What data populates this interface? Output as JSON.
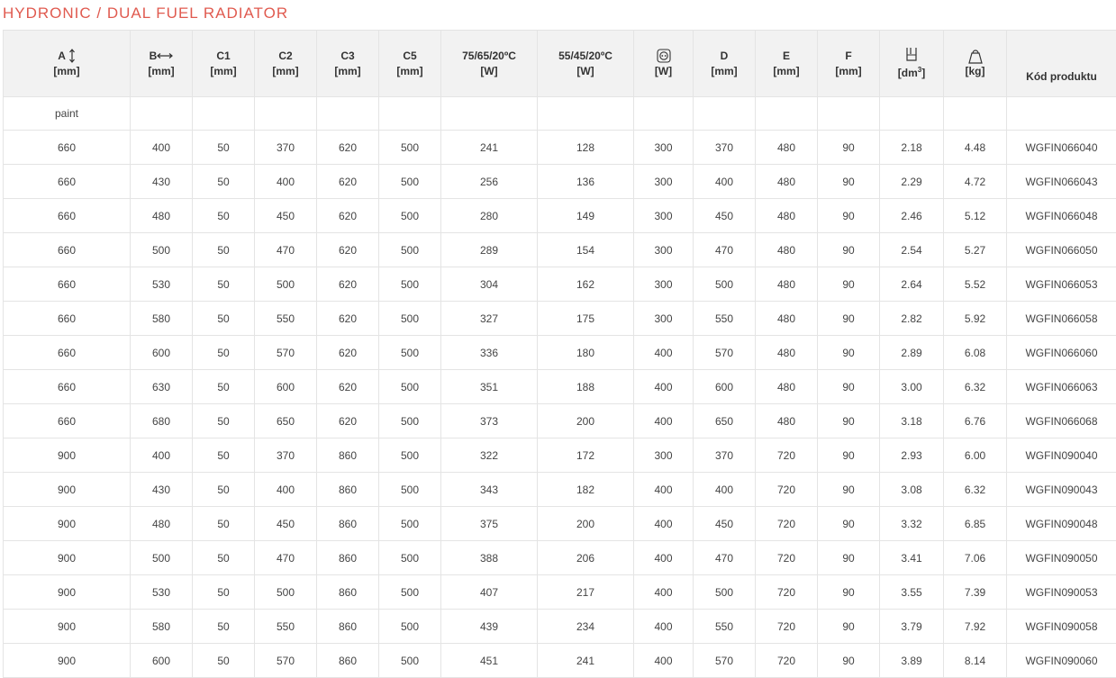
{
  "title": "HYDRONIC / DUAL FUEL RADIATOR",
  "headers": {
    "a": {
      "label": "A",
      "unit": "[mm]",
      "icon": "vertical-arrow-icon"
    },
    "b": {
      "label": "B",
      "unit": "[mm]",
      "icon": "horizontal-arrow-icon"
    },
    "c1": {
      "label": "C1",
      "unit": "[mm]"
    },
    "c2": {
      "label": "C2",
      "unit": "[mm]"
    },
    "c3": {
      "label": "C3",
      "unit": "[mm]"
    },
    "c5": {
      "label": "C5",
      "unit": "[mm]"
    },
    "p75": {
      "label": "75/65/20ºC",
      "unit": "[W]"
    },
    "p55": {
      "label": "55/45/20ºC",
      "unit": "[W]"
    },
    "heater": {
      "unit": "[W]",
      "icon": "power-socket-icon"
    },
    "d": {
      "label": "D",
      "unit": "[mm]"
    },
    "e": {
      "label": "E",
      "unit": "[mm]"
    },
    "f": {
      "label": "F",
      "unit": "[mm]"
    },
    "volume": {
      "unit": "[dm",
      "sup": "3",
      "unit_end": "]",
      "icon": "water-container-icon"
    },
    "weight": {
      "unit": "[kg]",
      "icon": "weight-icon"
    },
    "code": {
      "label": "Kód produktu"
    }
  },
  "paint_label": "paint",
  "rows": [
    [
      "660",
      "400",
      "50",
      "370",
      "620",
      "500",
      "241",
      "128",
      "300",
      "370",
      "480",
      "90",
      "2.18",
      "4.48",
      "WGFIN066040"
    ],
    [
      "660",
      "430",
      "50",
      "400",
      "620",
      "500",
      "256",
      "136",
      "300",
      "400",
      "480",
      "90",
      "2.29",
      "4.72",
      "WGFIN066043"
    ],
    [
      "660",
      "480",
      "50",
      "450",
      "620",
      "500",
      "280",
      "149",
      "300",
      "450",
      "480",
      "90",
      "2.46",
      "5.12",
      "WGFIN066048"
    ],
    [
      "660",
      "500",
      "50",
      "470",
      "620",
      "500",
      "289",
      "154",
      "300",
      "470",
      "480",
      "90",
      "2.54",
      "5.27",
      "WGFIN066050"
    ],
    [
      "660",
      "530",
      "50",
      "500",
      "620",
      "500",
      "304",
      "162",
      "300",
      "500",
      "480",
      "90",
      "2.64",
      "5.52",
      "WGFIN066053"
    ],
    [
      "660",
      "580",
      "50",
      "550",
      "620",
      "500",
      "327",
      "175",
      "300",
      "550",
      "480",
      "90",
      "2.82",
      "5.92",
      "WGFIN066058"
    ],
    [
      "660",
      "600",
      "50",
      "570",
      "620",
      "500",
      "336",
      "180",
      "400",
      "570",
      "480",
      "90",
      "2.89",
      "6.08",
      "WGFIN066060"
    ],
    [
      "660",
      "630",
      "50",
      "600",
      "620",
      "500",
      "351",
      "188",
      "400",
      "600",
      "480",
      "90",
      "3.00",
      "6.32",
      "WGFIN066063"
    ],
    [
      "660",
      "680",
      "50",
      "650",
      "620",
      "500",
      "373",
      "200",
      "400",
      "650",
      "480",
      "90",
      "3.18",
      "6.76",
      "WGFIN066068"
    ],
    [
      "900",
      "400",
      "50",
      "370",
      "860",
      "500",
      "322",
      "172",
      "300",
      "370",
      "720",
      "90",
      "2.93",
      "6.00",
      "WGFIN090040"
    ],
    [
      "900",
      "430",
      "50",
      "400",
      "860",
      "500",
      "343",
      "182",
      "400",
      "400",
      "720",
      "90",
      "3.08",
      "6.32",
      "WGFIN090043"
    ],
    [
      "900",
      "480",
      "50",
      "450",
      "860",
      "500",
      "375",
      "200",
      "400",
      "450",
      "720",
      "90",
      "3.32",
      "6.85",
      "WGFIN090048"
    ],
    [
      "900",
      "500",
      "50",
      "470",
      "860",
      "500",
      "388",
      "206",
      "400",
      "470",
      "720",
      "90",
      "3.41",
      "7.06",
      "WGFIN090050"
    ],
    [
      "900",
      "530",
      "50",
      "500",
      "860",
      "500",
      "407",
      "217",
      "400",
      "500",
      "720",
      "90",
      "3.55",
      "7.39",
      "WGFIN090053"
    ],
    [
      "900",
      "580",
      "50",
      "550",
      "860",
      "500",
      "439",
      "234",
      "400",
      "550",
      "720",
      "90",
      "3.79",
      "7.92",
      "WGFIN090058"
    ],
    [
      "900",
      "600",
      "50",
      "570",
      "860",
      "500",
      "451",
      "241",
      "400",
      "570",
      "720",
      "90",
      "3.89",
      "8.14",
      "WGFIN090060"
    ]
  ]
}
